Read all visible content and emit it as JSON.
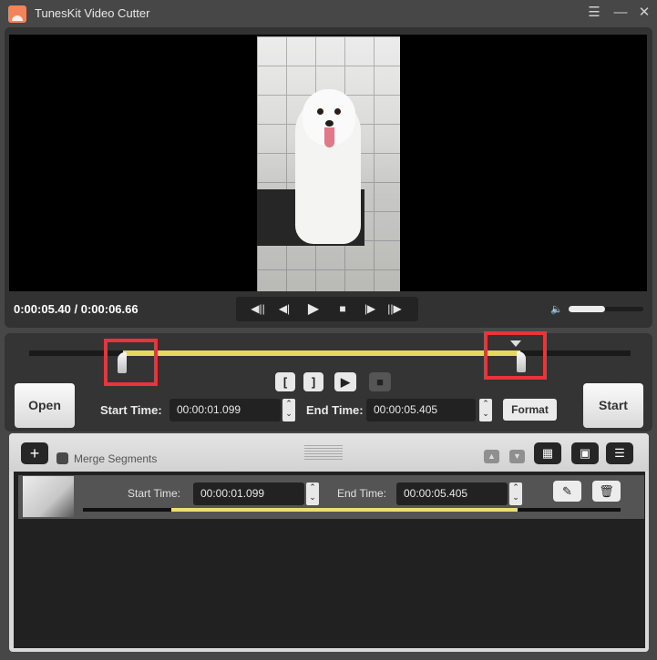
{
  "window": {
    "title": "TunesKit Video Cutter",
    "icons": {
      "app": "film-clapper-icon",
      "menu": "menu-icon",
      "minimize": "minimize-icon",
      "close": "close-icon"
    },
    "menu_glyph": "☰",
    "minimize_glyph": "—",
    "close_glyph": "✕"
  },
  "player": {
    "current_time": "0:00:05.40",
    "total_time": "0:00:06.66",
    "time_display": "0:00:05.40 / 0:00:06.66",
    "controls": [
      {
        "name": "previous-segment",
        "glyph": "◀||"
      },
      {
        "name": "previous-frame",
        "glyph": "◀|"
      },
      {
        "name": "play",
        "glyph": "▶"
      },
      {
        "name": "stop",
        "glyph": "■"
      },
      {
        "name": "next-frame",
        "glyph": "|▶"
      },
      {
        "name": "next-segment",
        "glyph": "||▶"
      }
    ],
    "volume_glyph": "🔈",
    "volume_level": 0.5
  },
  "trimmer": {
    "selection_start_fraction": 0.165,
    "selection_end_fraction": 0.811,
    "mark_in_glyph": "[",
    "mark_out_glyph": "]",
    "preview_glyph": "▶",
    "stop_glyph": "■",
    "open_label": "Open",
    "start_label": "Start",
    "start_time_label": "Start Time:",
    "start_time_value": "00:00:01.099",
    "end_time_label": "End Time:",
    "end_time_value": "00:00:05.405",
    "format_label": "Format",
    "spin_up": "⌃",
    "spin_down": "⌄"
  },
  "segments": {
    "add_glyph": "+",
    "merge_label": "Merge Segments",
    "merge_checked": false,
    "move_up_glyph": "▲",
    "move_down_glyph": "▼",
    "toolbar_icons": [
      "effects-icon",
      "output-folder-icon",
      "segment-list-icon"
    ],
    "items": [
      {
        "start_time_label": "Start Time:",
        "start_time": "00:00:01.099",
        "end_time_label": "End Time:",
        "end_time": "00:00:05.405",
        "edit_glyph": "✎",
        "delete_glyph": "🗑"
      }
    ]
  }
}
